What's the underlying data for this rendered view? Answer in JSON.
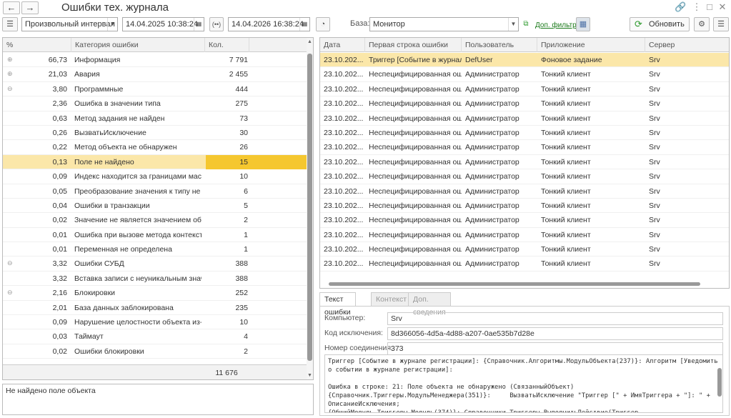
{
  "window": {
    "title": "Ошибки тех. журнала",
    "back_glyph": "←",
    "forward_glyph": "→"
  },
  "toolbar": {
    "menu_glyph": "☰",
    "interval_select": "Произвольный интервал",
    "date_from": "14.04.2025 10:38:24",
    "date_to": "14.04.2026 16:38:24",
    "period_glyph": "(••)",
    "base_label": "База:",
    "base_value": "Монитор",
    "extra_filter_link": "Доп. фильтр",
    "refresh_label": "Обновить"
  },
  "left_table": {
    "headers": {
      "pct": "%",
      "category": "Категория ошибки",
      "count": "Кол."
    },
    "rows": [
      {
        "expander": "⊕",
        "pct": "66,73",
        "category": "Информация",
        "count": "7 791"
      },
      {
        "expander": "⊕",
        "pct": "21,03",
        "category": "Авария",
        "count": "2 455"
      },
      {
        "expander": "⊖",
        "pct": "3,80",
        "category": "Программные",
        "count": "444"
      },
      {
        "expander": "",
        "pct": "2,36",
        "category": "Ошибка в значении типа",
        "count": "275"
      },
      {
        "expander": "",
        "pct": "0,63",
        "category": "Метод задания не найден",
        "count": "73"
      },
      {
        "expander": "",
        "pct": "0,26",
        "category": "ВызватьИсключение",
        "count": "30"
      },
      {
        "expander": "",
        "pct": "0,22",
        "category": "Метод объекта не обнаружен",
        "count": "26"
      },
      {
        "expander": "",
        "pct": "0,13",
        "category": "Поле не найдено",
        "count": "15",
        "selected": true
      },
      {
        "expander": "",
        "pct": "0,09",
        "category": "Индекс находится за границами массива",
        "count": "10"
      },
      {
        "expander": "",
        "pct": "0,05",
        "category": "Преобразование значения к типу не мо...",
        "count": "6"
      },
      {
        "expander": "",
        "pct": "0,04",
        "category": "Ошибки в транзакции",
        "count": "5"
      },
      {
        "expander": "",
        "pct": "0,02",
        "category": "Значение не является значением объе...",
        "count": "2"
      },
      {
        "expander": "",
        "pct": "0,01",
        "category": "Ошибка при вызове метода контекста",
        "count": "1"
      },
      {
        "expander": "",
        "pct": "0,01",
        "category": "Переменная не определена",
        "count": "1"
      },
      {
        "expander": "⊖",
        "pct": "3,32",
        "category": "Ошибки СУБД",
        "count": "388"
      },
      {
        "expander": "",
        "pct": "3,32",
        "category": "Вставка записи с неуникальным значе...",
        "count": "388"
      },
      {
        "expander": "⊖",
        "pct": "2,16",
        "category": "Блокировки",
        "count": "252"
      },
      {
        "expander": "",
        "pct": "2,01",
        "category": "База данных заблокирована",
        "count": "235"
      },
      {
        "expander": "",
        "pct": "0,09",
        "category": "Нарушение целостности объекта из-за ...",
        "count": "10"
      },
      {
        "expander": "",
        "pct": "0,03",
        "category": "Таймаут",
        "count": "4"
      },
      {
        "expander": "",
        "pct": "0,02",
        "category": "Ошибки блокировки",
        "count": "2"
      }
    ],
    "total": "11 676"
  },
  "message_box": "Не найдено поле объекта",
  "right_table": {
    "headers": {
      "date": "Дата",
      "first_line": "Первая строка ошибки",
      "user": "Пользователь",
      "app": "Приложение",
      "server": "Сервер"
    },
    "rows": [
      {
        "date": "23.10.202...",
        "first_line": "Триггер [Событие в журнал...",
        "user": "DefUser",
        "app": "Фоновое задание",
        "server": "Srv",
        "selected": true
      },
      {
        "date": "23.10.202...",
        "first_line": "Неспецифицированная ош...",
        "user": "Администратор",
        "app": "Тонкий клиент",
        "server": "Srv"
      },
      {
        "date": "23.10.202...",
        "first_line": "Неспецифицированная ош...",
        "user": "Администратор",
        "app": "Тонкий клиент",
        "server": "Srv"
      },
      {
        "date": "23.10.202...",
        "first_line": "Неспецифицированная ош...",
        "user": "Администратор",
        "app": "Тонкий клиент",
        "server": "Srv"
      },
      {
        "date": "23.10.202...",
        "first_line": "Неспецифицированная ош...",
        "user": "Администратор",
        "app": "Тонкий клиент",
        "server": "Srv"
      },
      {
        "date": "23.10.202...",
        "first_line": "Неспецифицированная ош...",
        "user": "Администратор",
        "app": "Тонкий клиент",
        "server": "Srv"
      },
      {
        "date": "23.10.202...",
        "first_line": "Неспецифицированная ош...",
        "user": "Администратор",
        "app": "Тонкий клиент",
        "server": "Srv"
      },
      {
        "date": "23.10.202...",
        "first_line": "Неспецифицированная ош...",
        "user": "Администратор",
        "app": "Тонкий клиент",
        "server": "Srv"
      },
      {
        "date": "23.10.202...",
        "first_line": "Неспецифицированная ош...",
        "user": "Администратор",
        "app": "Тонкий клиент",
        "server": "Srv"
      },
      {
        "date": "23.10.202...",
        "first_line": "Неспецифицированная ош...",
        "user": "Администратор",
        "app": "Тонкий клиент",
        "server": "Srv"
      },
      {
        "date": "23.10.202...",
        "first_line": "Неспецифицированная ош...",
        "user": "Администратор",
        "app": "Тонкий клиент",
        "server": "Srv"
      },
      {
        "date": "23.10.202...",
        "first_line": "Неспецифицированная ош...",
        "user": "Администратор",
        "app": "Тонкий клиент",
        "server": "Srv"
      },
      {
        "date": "23.10.202...",
        "first_line": "Неспецифицированная ош...",
        "user": "Администратор",
        "app": "Тонкий клиент",
        "server": "Srv"
      },
      {
        "date": "23.10.202...",
        "first_line": "Неспецифицированная ош...",
        "user": "Администратор",
        "app": "Тонкий клиент",
        "server": "Srv"
      },
      {
        "date": "23.10.202...",
        "first_line": "Неспецифицированная ош...",
        "user": "Администратор",
        "app": "Тонкий клиент",
        "server": "Srv"
      }
    ]
  },
  "tabs": [
    "Текст ошибки",
    "Контекст",
    "Доп. сведения"
  ],
  "details": {
    "computer_label": "Компьютер:",
    "computer_value": "Srv",
    "exception_label": "Код исключения:",
    "exception_value": "8d366056-4d5a-4d88-a207-0ae535b7d28e",
    "connection_label": "Номер соединения:",
    "connection_value": "373",
    "error_text": "Триггер [Событие в журнале регистрации]: {Справочник.Алгоритмы.МодульОбъекта(237)}: Алгоритм [Уведомить о событии в журнале регистрации]:\n\nОшибка в строке: 21: Поле объекта не обнаружено (СвязанныйОбъект)\n{Справочник.Триггеры.МодульМенеджера(351)}:     ВызватьИсключение \"Триггер [\" + ИмяТриггера + \"]: \" + ОписаниеИсключения;\n{ОбщийМодуль.Триггеры.Модуль(374)}: Справочники.Триггеры.ВыполнитьДействие(Триггер, КлючРазрешенияВыполнения);"
  }
}
